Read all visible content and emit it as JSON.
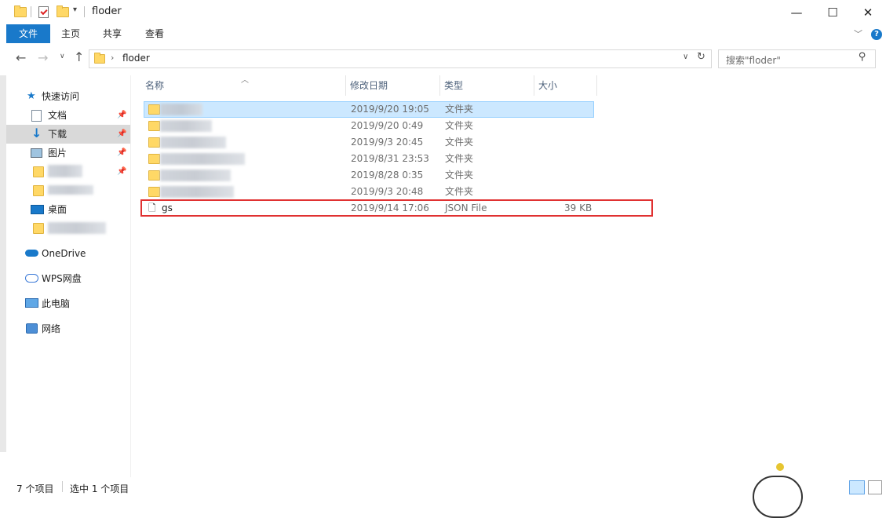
{
  "title": "floder",
  "window_controls": {
    "minimize": "—",
    "maximize": "☐",
    "close": "✕"
  },
  "ribbon": {
    "tabs": [
      "文件",
      "主页",
      "共享",
      "查看"
    ],
    "help": "?"
  },
  "address": {
    "path": "floder",
    "search_placeholder": "搜索\"floder\""
  },
  "sidebar": {
    "quick_access": "快速访问",
    "items": [
      {
        "label": "文档",
        "icon": "document-icon",
        "pinned": true
      },
      {
        "label": "下载",
        "icon": "download-icon",
        "pinned": true,
        "selected": true
      },
      {
        "label": "图片",
        "icon": "picture-icon",
        "pinned": true
      },
      {
        "label": "",
        "icon": "folder-icon",
        "pinned": true
      },
      {
        "label": "",
        "icon": "folder-icon",
        "pinned": false
      },
      {
        "label": "桌面",
        "icon": "desktop-icon",
        "pinned": false
      },
      {
        "label": "",
        "icon": "folder-icon",
        "pinned": false
      }
    ],
    "onedrive": "OneDrive",
    "wps": "WPS网盘",
    "this_pc": "此电脑",
    "network": "网络"
  },
  "columns": [
    "名称",
    "修改日期",
    "类型",
    "大小"
  ],
  "files": [
    {
      "name": "",
      "date": "2019/9/20 19:05",
      "type": "文件夹",
      "size": "",
      "selected": true
    },
    {
      "name": "",
      "date": "2019/9/20 0:49",
      "type": "文件夹",
      "size": ""
    },
    {
      "name": "",
      "date": "2019/9/3 20:45",
      "type": "文件夹",
      "size": ""
    },
    {
      "name": "",
      "date": "2019/8/31 23:53",
      "type": "文件夹",
      "size": ""
    },
    {
      "name": "",
      "date": "2019/8/28 0:35",
      "type": "文件夹",
      "size": ""
    },
    {
      "name": "",
      "date": "2019/9/3 20:48",
      "type": "文件夹",
      "size": ""
    },
    {
      "name": "gs",
      "date": "2019/9/14 17:06",
      "type": "JSON File",
      "size": "39 KB",
      "highlighted": true
    }
  ],
  "status": {
    "item_count": "7 个项目",
    "selected_count": "选中 1 个项目"
  },
  "colors": {
    "accent": "#1979ca",
    "selection": "#cce8ff",
    "highlight_box": "#e03131"
  }
}
